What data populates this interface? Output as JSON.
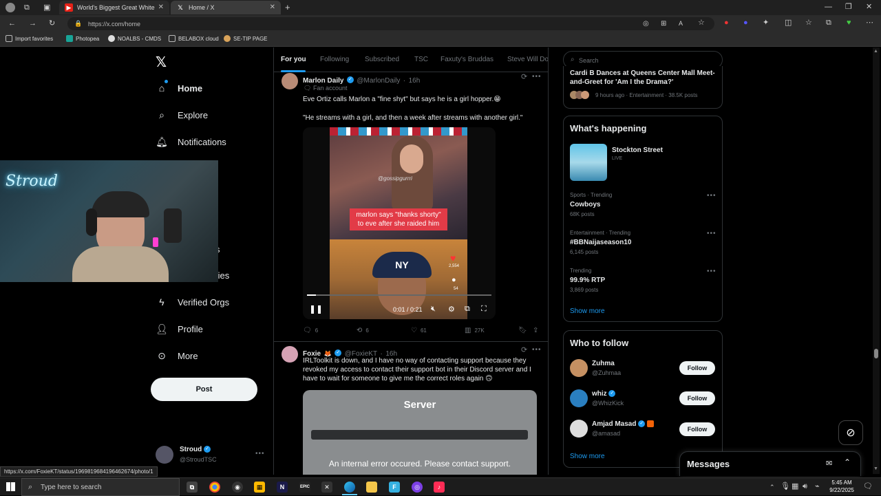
{
  "browser": {
    "tabs": [
      {
        "title": "World's Biggest Great White Ful"
      },
      {
        "title": "Home / X"
      }
    ],
    "url": "https://x.com/home",
    "favorites": [
      "Import favorites",
      "Photopea",
      "NOALBS - CMDS",
      "BELABOX cloud",
      "SE-TIP PAGE"
    ],
    "status_url": "https://x.com/FoxieKT/status/1969819684196462674/photo/1"
  },
  "nav": {
    "items": [
      {
        "label": "Home"
      },
      {
        "label": "Explore"
      },
      {
        "label": "Notifications"
      },
      {
        "label": "s"
      },
      {
        "label": "ties"
      },
      {
        "label": "Verified Orgs"
      },
      {
        "label": "Profile"
      },
      {
        "label": "More"
      }
    ],
    "post_button": "Post",
    "account": {
      "name": "Stroud",
      "handle": "@StroudTSC"
    }
  },
  "webcam": {
    "sign_text": "Stroud"
  },
  "timeline": {
    "tabs": [
      "For you",
      "Following",
      "Subscribed",
      "TSC",
      "Faxuty's Bruddas",
      "Steve Will Do"
    ],
    "posts": [
      {
        "name": "Marlon Daily",
        "handle": "@MarlonDaily",
        "time": "16h",
        "badge": "Fan account",
        "text1": "Eve Ortiz calls Marlon a \"fine shyt\" but says he is a girl hopper.😁",
        "text2": "\"He streams with a girl, and then a week after streams with another girl.\"",
        "video": {
          "caption": "marlon says \"thanks shorty\" to eve after she raided him",
          "watermark": "@gossipgurrri",
          "likes": "2,554",
          "comments": "54",
          "progress": 0.05,
          "time": "0:01 / 0:21"
        },
        "stats": {
          "replies": "6",
          "reposts": "6",
          "likes": "61",
          "views": "27K"
        }
      },
      {
        "name": "Foxie",
        "handle": "@FoxieKT",
        "time": "16h",
        "text": "IRLToolkit is down, and I have no way of contacting support because they revoked my access to contact their support bot in their Discord server and I have to wait for someone to give me the correct roles again 🙃",
        "image": {
          "title": "Server",
          "error": "An internal error occured. Please contact support."
        }
      }
    ]
  },
  "sidebar": {
    "search_placeholder": "Search",
    "top_news": {
      "title": "Cardi B Dances at Queens Center Mall Meet-and-Greet for 'Am I the Drama?'",
      "meta": "9 hours ago · Entertainment · 38.5K posts"
    },
    "happening": {
      "heading": "What's happening",
      "live": {
        "title": "Stockton Street",
        "status": "LIVE"
      },
      "trends": [
        {
          "meta": "Sports · Trending",
          "name": "Cowboys",
          "posts": "68K posts"
        },
        {
          "meta": "Entertainment · Trending",
          "name": "#BBNaijaseason10",
          "posts": "6,145 posts"
        },
        {
          "meta": "Trending",
          "name": "99.9% RTP",
          "posts": "3,869 posts"
        }
      ],
      "show_more": "Show more"
    },
    "who_to_follow": {
      "heading": "Who to follow",
      "users": [
        {
          "name": "Zuhma",
          "handle": "@Zuhmaa",
          "button": "Follow"
        },
        {
          "name": "whiz",
          "handle": "@WhizKick",
          "button": "Follow"
        },
        {
          "name": "Amjad Masad",
          "handle": "@amasad",
          "button": "Follow"
        }
      ],
      "show_more": "Show more"
    },
    "messages": "Messages"
  },
  "taskbar": {
    "search": "Type here to search",
    "time": "5:45 AM",
    "date": "9/22/2025"
  },
  "colors": {
    "accent": "#1d9bf0",
    "bg": "#000000",
    "border": "#2f3336"
  }
}
